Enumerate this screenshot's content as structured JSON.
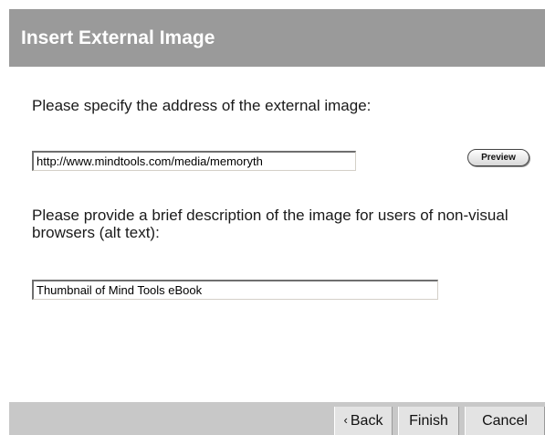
{
  "header": {
    "title": "Insert External Image"
  },
  "url_section": {
    "prompt": "Please specify the address of the external image:",
    "value": "http://www.mindtools.com/media/memoryth",
    "preview_label": "Preview"
  },
  "alt_section": {
    "prompt": "Please provide a brief description of the image for users of non-visual browsers (alt text):",
    "value": "Thumbnail of Mind Tools eBook"
  },
  "footer": {
    "back_icon": "‹",
    "back_label": "Back",
    "finish_label": "Finish",
    "cancel_label": "Cancel"
  },
  "colors": {
    "title_bar": "#9a9a9a",
    "footer_bar": "#c8c8c8",
    "button_bg": "#e3e3e3"
  }
}
